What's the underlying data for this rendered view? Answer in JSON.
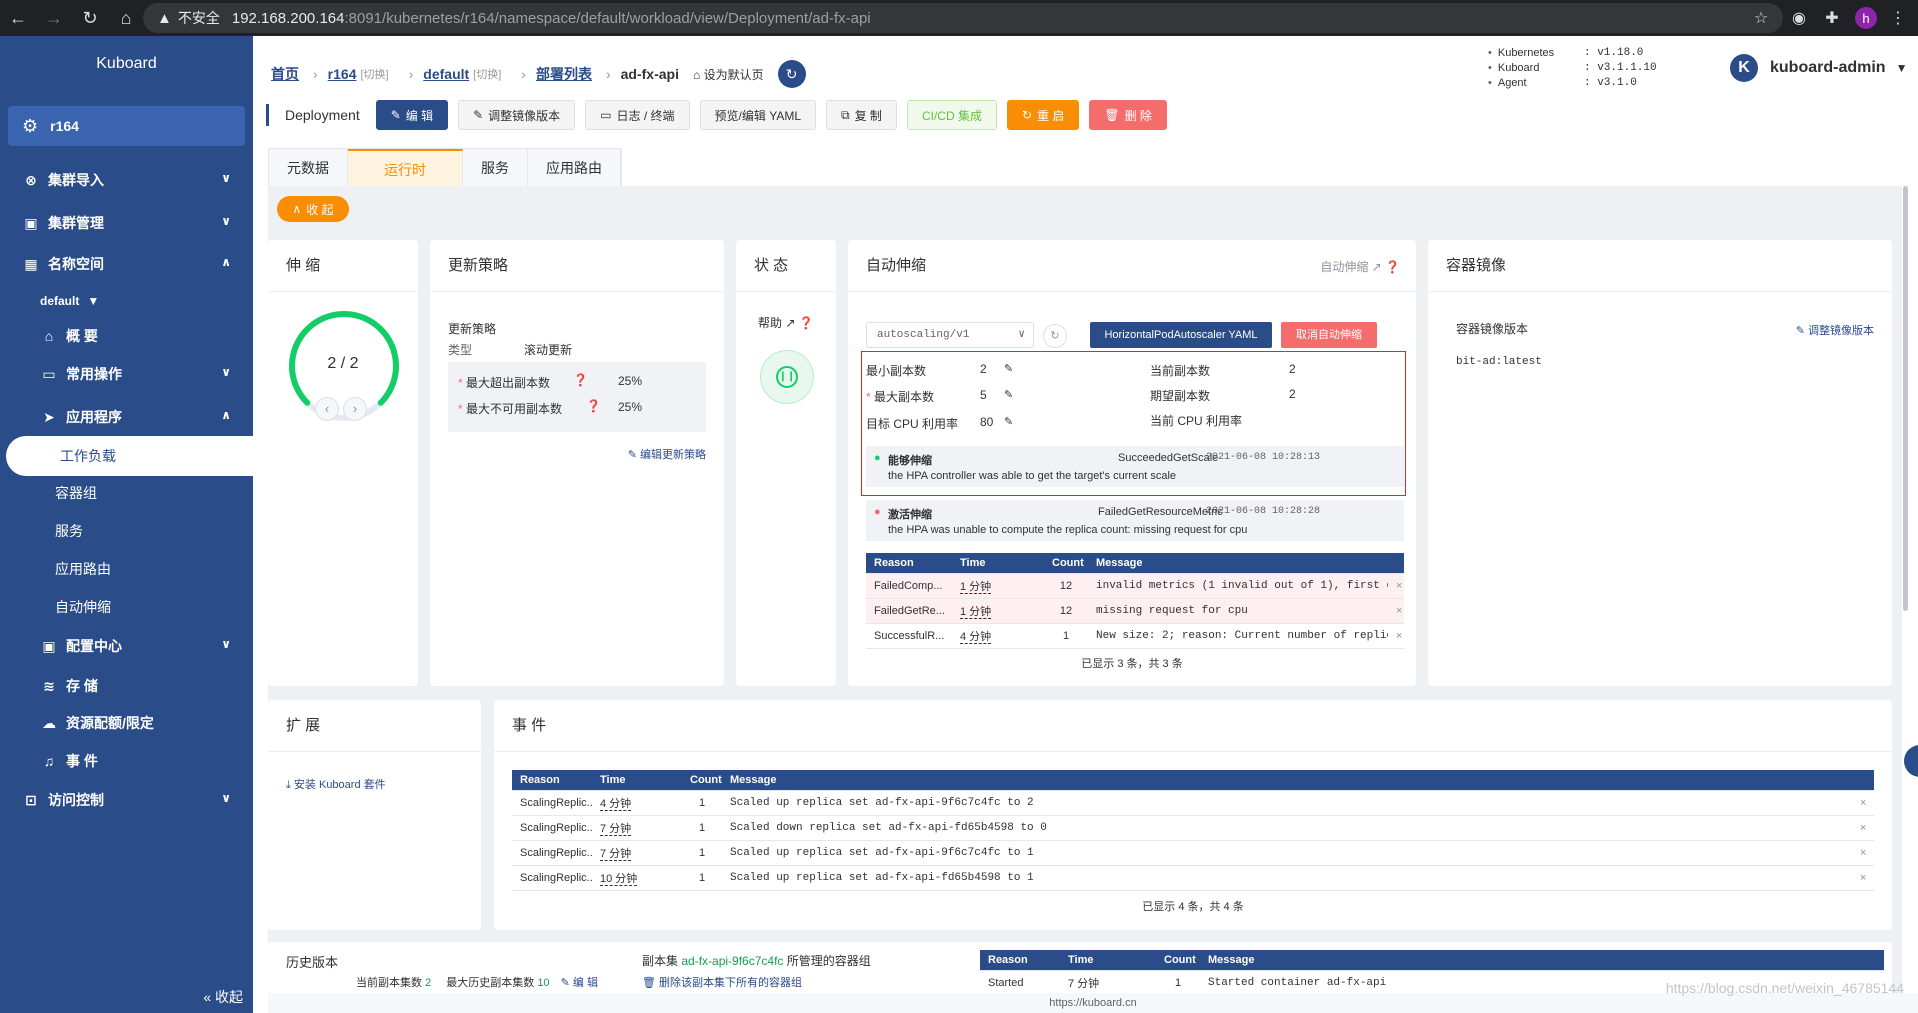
{
  "browser": {
    "warning": "▲",
    "insecure": "不安全",
    "host": "192.168.200.164",
    "path": ":8091/kubernetes/r164/namespace/default/workload/view/Deployment/ad-fx-api"
  },
  "sidebar": {
    "brand": "Kuboard",
    "cluster": "r164",
    "menus": [
      {
        "label": "集群导入"
      },
      {
        "label": "集群管理"
      },
      {
        "label": "名称空间"
      },
      {
        "label": "default"
      },
      {
        "label": "概 要"
      },
      {
        "label": "常用操作"
      },
      {
        "label": "应用程序"
      },
      {
        "label": "工作负载"
      },
      {
        "label": "容器组"
      },
      {
        "label": "服务"
      },
      {
        "label": "应用路由"
      },
      {
        "label": "自动伸缩"
      },
      {
        "label": "配置中心"
      },
      {
        "label": "存 储"
      },
      {
        "label": "资源配额/限定"
      },
      {
        "label": "事 件"
      },
      {
        "label": "访问控制"
      }
    ],
    "collapse": "« 收起"
  },
  "breadcrumb": {
    "home": "首页",
    "cluster": "r164",
    "switch": "[切换]",
    "namespace": "default",
    "list": "部署列表",
    "current": "ad-fx-api",
    "set_default": "设为默认页"
  },
  "versions": [
    {
      "k": "Kubernetes",
      "v": ":  v1.18.0"
    },
    {
      "k": "Kuboard",
      "v": ":  v3.1.1.10"
    },
    {
      "k": "Agent",
      "v": ":  v3.1.0"
    }
  ],
  "user": {
    "initial": "K",
    "name": "kuboard-admin"
  },
  "toolbar": {
    "kind": "Deployment",
    "edit": "编 辑",
    "adjust_image": "调整镜像版本",
    "logs": "日志 / 终端",
    "yaml": "预览/编辑 YAML",
    "copy": "复 制",
    "cicd": "CI/CD 集成",
    "restart": "重 启",
    "delete": "删 除"
  },
  "tabs": [
    "元数据",
    "运行时",
    "服务",
    "应用路由"
  ],
  "collapse_btn": "收 起",
  "scale": {
    "title": "伸 缩",
    "value": "2 / 2",
    "fraction": 1.0
  },
  "strategy": {
    "title": "更新策略",
    "section": "更新策略",
    "type_label": "类型",
    "type_value": "滚动更新",
    "max_surge_label": "最大超出副本数",
    "max_surge": "25%",
    "max_unavail_label": "最大不可用副本数",
    "max_unavail": "25%",
    "edit": "编辑更新策略"
  },
  "status": {
    "title": "状 态",
    "help": "帮助"
  },
  "hpa": {
    "title": "自动伸缩",
    "link": "自动伸缩",
    "api_version": "autoscaling/v1",
    "yaml_btn": "HorizontalPodAutoscaler YAML",
    "cancel_btn": "取消自动伸缩",
    "min_label": "最小副本数",
    "min": "2",
    "max_label": "最大副本数",
    "max": "5",
    "cpu_label": "目标 CPU 利用率",
    "cpu": "80",
    "cur_label": "当前副本数",
    "cur": "2",
    "desired_label": "期望副本数",
    "desired": "2",
    "cur_cpu_label": "当前 CPU 利用率",
    "conditions": [
      {
        "type": "能够伸缩",
        "reason": "SucceededGetScale",
        "time": "2021-06-08 10:28:13",
        "message": "the HPA controller was able to get the target's current scale",
        "ok": true
      },
      {
        "type": "激活伸缩",
        "reason": "FailedGetResourceMetric",
        "time": "2021-06-08 10:28:28",
        "message": "the HPA was unable to compute the replica count: missing request for cpu",
        "ok": false
      }
    ],
    "events_header": {
      "reason": "Reason",
      "time": "Time",
      "count": "Count",
      "message": "Message"
    },
    "events": [
      {
        "reason": "FailedComp...",
        "time": "1 分钟",
        "count": "12",
        "message": "invalid metrics (1 invalid out of 1), first e…",
        "warn": true
      },
      {
        "reason": "FailedGetRe...",
        "time": "1 分钟",
        "count": "12",
        "message": "missing request for cpu",
        "warn": true
      },
      {
        "reason": "SuccessfulR...",
        "time": "4 分钟",
        "count": "1",
        "message": "New size: 2; reason: Current number of replic…",
        "warn": false
      }
    ],
    "summary": "已显示 3 条，共 3 条"
  },
  "image": {
    "title": "容器镜像",
    "label": "容器镜像版本",
    "adjust": "调整镜像版本",
    "value": "bit-ad:latest"
  },
  "ext": {
    "title": "扩 展",
    "install": "安装 Kuboard 套件"
  },
  "events": {
    "title": "事 件",
    "header": {
      "reason": "Reason",
      "time": "Time",
      "count": "Count",
      "message": "Message"
    },
    "rows": [
      {
        "reason": "ScalingReplic...",
        "time": "4 分钟",
        "count": "1",
        "message": "Scaled up replica set ad-fx-api-9f6c7c4fc to 2"
      },
      {
        "reason": "ScalingReplic...",
        "time": "7 分钟",
        "count": "1",
        "message": "Scaled down replica set ad-fx-api-fd65b4598 to 0"
      },
      {
        "reason": "ScalingReplic...",
        "time": "7 分钟",
        "count": "1",
        "message": "Scaled up replica set ad-fx-api-9f6c7c4fc to 1"
      },
      {
        "reason": "ScalingReplic...",
        "time": "10 分钟",
        "count": "1",
        "message": "Scaled up replica set ad-fx-api-fd65b4598 to 1"
      }
    ],
    "summary": "已显示 4 条，共 4 条"
  },
  "history": {
    "title": "历史版本",
    "cur_label": "当前副本集数",
    "cur": "2",
    "max_label": "最大历史副本集数",
    "max": "10",
    "edit": "编 辑",
    "rs_prefix": "副本集",
    "rs_name": "ad-fx-api-9f6c7c4fc",
    "rs_suffix": "所管理的容器组",
    "delete_pods": "删除该副本集下所有的容器组",
    "event": {
      "reason": "Started",
      "time": "7 分钟",
      "count": "1",
      "message": "Started container ad-fx-api"
    }
  },
  "footer": {
    "url": "https://kuboard.cn",
    "watermark": "https://blog.csdn.net/weixin_46785144"
  },
  "colors": {
    "primary": "#2a4c88",
    "accent": "#f98d06",
    "danger": "#f56c6c",
    "success": "#13ce66"
  }
}
